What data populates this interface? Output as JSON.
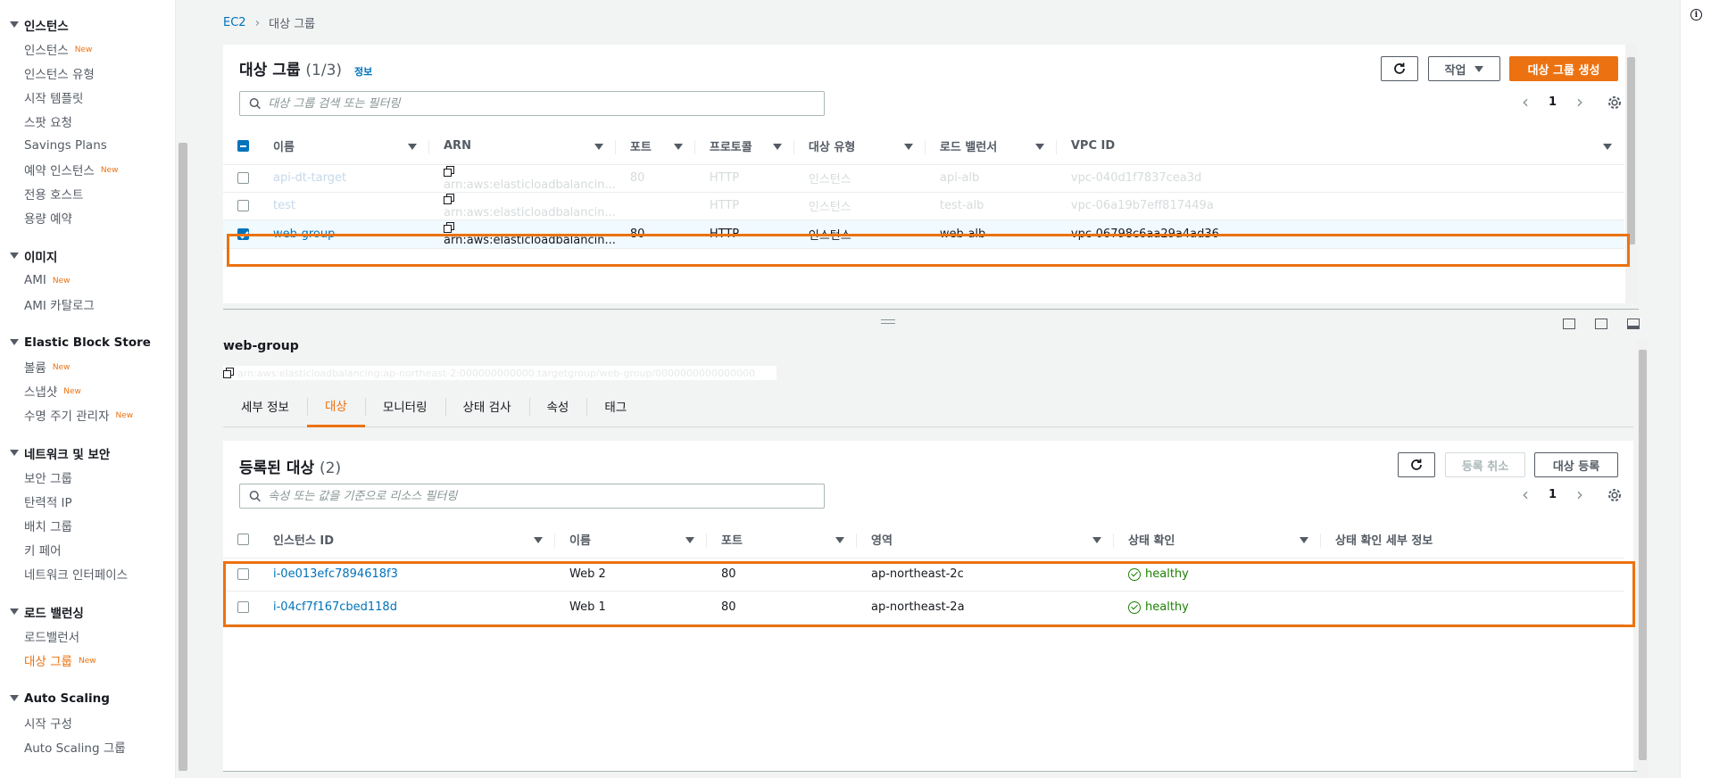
{
  "sidebar": {
    "sections": [
      {
        "title": "인스턴스",
        "items": [
          {
            "label": "인스턴스",
            "new": "New"
          },
          {
            "label": "인스턴스 유형",
            "new": ""
          },
          {
            "label": "시작 템플릿",
            "new": ""
          },
          {
            "label": "스팟 요청",
            "new": ""
          },
          {
            "label": "Savings Plans",
            "new": ""
          },
          {
            "label": "예약 인스턴스",
            "new": "New"
          },
          {
            "label": "전용 호스트",
            "new": ""
          },
          {
            "label": "용량 예약",
            "new": ""
          }
        ]
      },
      {
        "title": "이미지",
        "items": [
          {
            "label": "AMI",
            "new": "New"
          },
          {
            "label": "AMI 카탈로그",
            "new": ""
          }
        ]
      },
      {
        "title": "Elastic Block Store",
        "items": [
          {
            "label": "볼륨",
            "new": "New"
          },
          {
            "label": "스냅샷",
            "new": "New"
          },
          {
            "label": "수명 주기 관리자",
            "new": "New"
          }
        ]
      },
      {
        "title": "네트워크 및 보안",
        "items": [
          {
            "label": "보안 그룹",
            "new": ""
          },
          {
            "label": "탄력적 IP",
            "new": ""
          },
          {
            "label": "배치 그룹",
            "new": ""
          },
          {
            "label": "키 페어",
            "new": ""
          },
          {
            "label": "네트워크 인터페이스",
            "new": ""
          }
        ]
      },
      {
        "title": "로드 밸런싱",
        "items": [
          {
            "label": "로드밸런서",
            "new": ""
          },
          {
            "label": "대상 그룹",
            "new": "New",
            "active": true
          }
        ]
      },
      {
        "title": "Auto Scaling",
        "items": [
          {
            "label": "시작 구성",
            "new": ""
          },
          {
            "label": "Auto Scaling 그룹",
            "new": ""
          }
        ]
      }
    ]
  },
  "breadcrumb": {
    "root": "EC2",
    "current": "대상 그룹"
  },
  "target_groups": {
    "title": "대상 그룹",
    "count": "(1/3)",
    "info": "정보",
    "actions_label": "작업",
    "create_label": "대상 그룹 생성",
    "search_placeholder": "대상 그룹 검색 또는 필터링",
    "page": "1",
    "columns": [
      "이름",
      "ARN",
      "포트",
      "프로토콜",
      "대상 유형",
      "로드 밸런서",
      "VPC ID"
    ],
    "rows": [
      {
        "name": "api-dt-target",
        "arn": "arn:aws:elasticloadbalancin...",
        "port": "80",
        "protocol": "HTTP",
        "type": "인스턴스",
        "lb": "api-alb",
        "vpc": "vpc-040d1f7837cea3d"
      },
      {
        "name": "test",
        "arn": "arn:aws:elasticloadbalancin...",
        "port": "",
        "protocol": "HTTP",
        "type": "인스턴스",
        "lb": "test-alb",
        "vpc": "vpc-06a19b7eff817449a"
      },
      {
        "name": "web-group",
        "arn": "arn:aws:elasticloadbalancin...",
        "port": "80",
        "protocol": "HTTP",
        "type": "인스턴스",
        "lb": "web-alb",
        "vpc": "vpc-06798c6aa29a4ad36"
      }
    ]
  },
  "detail": {
    "title": "web-group",
    "arn": "arn:aws:elasticloadbalancing:ap-northeast-2:000000000000:targetgroup/web-group/0000000000000000",
    "tabs": [
      "세부 정보",
      "대상",
      "모니터링",
      "상태 검사",
      "속성",
      "태그"
    ],
    "active_tab": "대상"
  },
  "registered": {
    "title": "등록된 대상",
    "count": "(2)",
    "deregister_label": "등록 취소",
    "register_label": "대상 등록",
    "search_placeholder": "속성 또는 값을 기준으로 리소스 필터링",
    "page": "1",
    "columns": [
      "인스턴스 ID",
      "이름",
      "포트",
      "영역",
      "상태 확인",
      "상태 확인 세부 정보"
    ],
    "rows": [
      {
        "id": "i-0e013efc7894618f3",
        "name": "Web 2",
        "port": "80",
        "zone": "ap-northeast-2c",
        "health": "healthy",
        "detail": ""
      },
      {
        "id": "i-04cf7f167cbed118d",
        "name": "Web 1",
        "port": "80",
        "zone": "ap-northeast-2a",
        "health": "healthy",
        "detail": ""
      }
    ]
  },
  "colors": {
    "accent": "#ec7211",
    "link": "#0073bb",
    "healthy": "#1d8102"
  }
}
